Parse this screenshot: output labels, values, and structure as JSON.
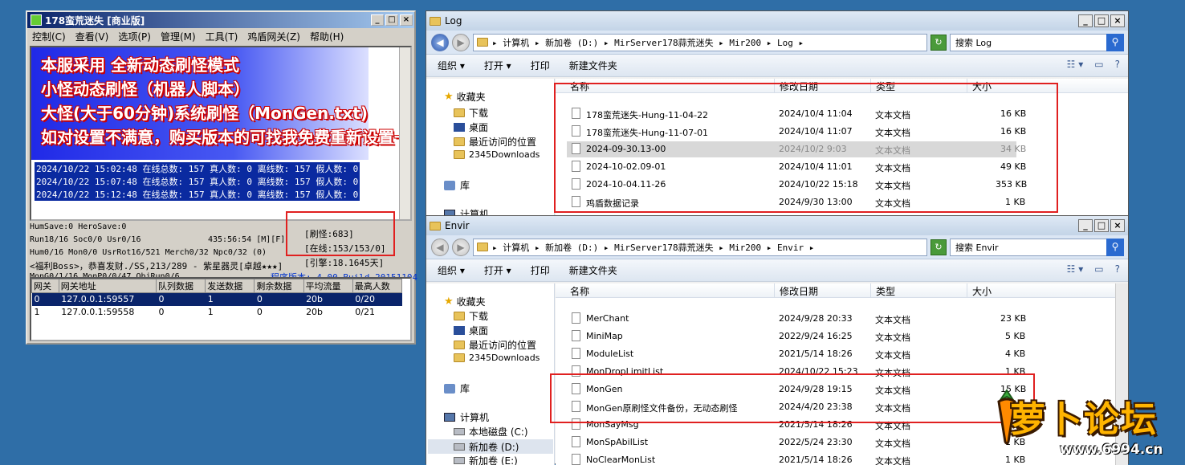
{
  "m2server": {
    "title": "178蛮荒迷失 [商业版]",
    "menu": [
      "控制(C)",
      "查看(V)",
      "选项(P)",
      "管理(M)",
      "工具(T)",
      "鸡盾网关(Z)",
      "帮助(H)"
    ],
    "promo_lines": [
      "本服采用 全新动态刷怪模式",
      "小怪动态刷怪（机器人脚本）",
      "大怪(大于60分钟)系统刷怪（MonGen.txt)",
      "如对设置不满意，购买版本的可找我免费重新设置一次"
    ],
    "log_lines": [
      "2024/10/22 15:02:48 在线总数: 157 真人数: 0 离线数: 157 假人数: 0",
      "2024/10/22 15:07:48 在线总数: 157 真人数: 0 离线数: 157 假人数: 0",
      "2024/10/22 15:12:48 在线总数: 157 真人数: 0 离线数: 157 假人数: 0"
    ],
    "status": {
      "line1": "HumSave:0 HeroSave:0",
      "line2": "Run18/16 Soc0/0 Usr0/16",
      "time": "435:56:54 [M][F]",
      "line3": "Hum0/16 Mon0/0 UsrRot16/521 Merch0/32 Npc0/32 (0)",
      "line4": "<福利Boss>，恭喜发财./SS,213/289 - 紫星器灵[卓越★★★]",
      "line5": "MonG0/1/16 MonP0/0/47 ObjRun0/6",
      "refresh": "[刷怪:683]",
      "online": "[在线:153/153/0]",
      "uptime": "[引擎:18.1645天]",
      "version": "程序版本: 4.00 Build 20151104"
    },
    "gateway_table": {
      "headers": [
        "网关",
        "网关地址",
        "队列数据",
        "发送数据",
        "剩余数据",
        "平均流量",
        "最高人数"
      ],
      "rows": [
        [
          "0",
          "127.0.0.1:59557",
          "0",
          "1",
          "0",
          "20b",
          "0/20"
        ],
        [
          "1",
          "127.0.0.1:59558",
          "0",
          "1",
          "0",
          "20b",
          "0/21"
        ]
      ]
    }
  },
  "log_window": {
    "title": "Log",
    "address": "▸ 计算机 ▸ 新加卷 (D:) ▸ MirServer178蒜荒迷失 ▸ Mir200 ▸ Log ▸",
    "search_placeholder": "搜索 Log",
    "toolbar": [
      "组织 ▾",
      "打开 ▾",
      "打印",
      "新建文件夹"
    ],
    "nav": [
      "收藏夹",
      "下载",
      "桌面",
      "最近访问的位置",
      "2345Downloads",
      "库",
      "计算机"
    ],
    "columns": [
      "名称",
      "修改日期",
      "类型",
      "大小"
    ],
    "files": [
      {
        "name": "178蛮荒迷失-Hung-11-04-22",
        "date": "2024/10/4 11:04",
        "type": "文本文档",
        "size": "16 KB"
      },
      {
        "name": "178蛮荒迷失-Hung-11-07-01",
        "date": "2024/10/4 11:07",
        "type": "文本文档",
        "size": "16 KB"
      },
      {
        "name": "2024-09-30.13-00",
        "date": "2024/10/2 9:03",
        "type": "文本文档",
        "size": "34 KB"
      },
      {
        "name": "2024-10-02.09-01",
        "date": "2024/10/4 11:01",
        "type": "文本文档",
        "size": "49 KB"
      },
      {
        "name": "2024-10-04.11-26",
        "date": "2024/10/22 15:18",
        "type": "文本文档",
        "size": "353 KB"
      },
      {
        "name": "鸡盾数据记录",
        "date": "2024/9/30 13:00",
        "type": "文本文档",
        "size": "1 KB"
      }
    ]
  },
  "envir_window": {
    "title": "Envir",
    "address": "▸ 计算机 ▸ 新加卷 (D:) ▸ MirServer178蒜荒迷失 ▸ Mir200 ▸ Envir ▸",
    "search_placeholder": "搜索 Envir",
    "toolbar": [
      "组织 ▾",
      "打开 ▾",
      "打印",
      "新建文件夹"
    ],
    "nav": [
      "收藏夹",
      "下载",
      "桌面",
      "最近访问的位置",
      "2345Downloads",
      "库",
      "计算机",
      "本地磁盘 (C:)",
      "新加卷 (D:)",
      "新加卷 (E:)"
    ],
    "columns": [
      "名称",
      "修改日期",
      "类型",
      "大小"
    ],
    "files": [
      {
        "name": "MerChant",
        "date": "2024/9/28 20:33",
        "type": "文本文档",
        "size": "23 KB"
      },
      {
        "name": "MiniMap",
        "date": "2022/9/24 16:25",
        "type": "文本文档",
        "size": "5 KB"
      },
      {
        "name": "ModuleList",
        "date": "2021/5/14 18:26",
        "type": "文本文档",
        "size": "4 KB"
      },
      {
        "name": "MonDropLimitList",
        "date": "2024/10/22 15:23",
        "type": "文本文档",
        "size": "1 KB"
      },
      {
        "name": "MonGen",
        "date": "2024/9/28 19:15",
        "type": "文本文档",
        "size": "15 KB"
      },
      {
        "name": "MonGen原刷怪文件备份，无动态刷怪",
        "date": "2024/4/20 23:38",
        "type": "文本文档",
        "size": "1 KB"
      },
      {
        "name": "MonSayMsg",
        "date": "2021/5/14 18:26",
        "type": "文本文档",
        "size": "1 KB"
      },
      {
        "name": "MonSpAbilList",
        "date": "2022/5/24 23:30",
        "type": "文本文档",
        "size": "1 KB"
      },
      {
        "name": "NoClearMonList",
        "date": "2021/5/14 18:26",
        "type": "文本文档",
        "size": "1 KB"
      }
    ]
  },
  "watermark": {
    "text": "萝卜论坛",
    "url": "www.6994.cn"
  }
}
